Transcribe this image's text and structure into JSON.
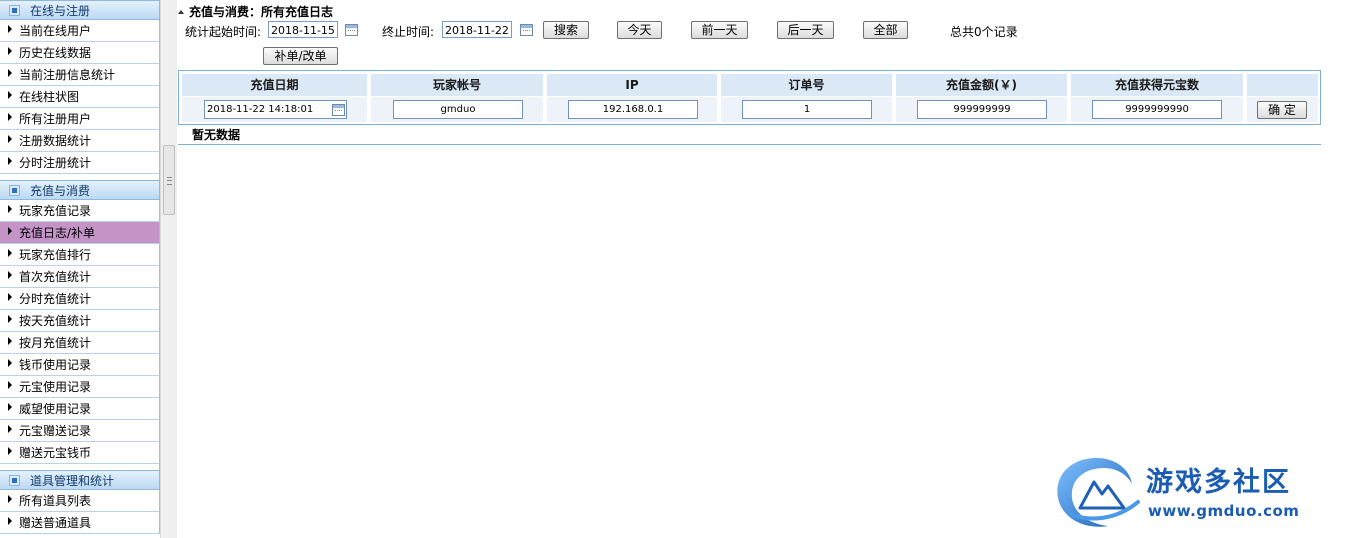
{
  "sidebar": {
    "groups": [
      {
        "title": "在线与注册",
        "items": [
          "当前在线用户",
          "历史在线数据",
          "当前注册信息统计",
          "在线柱状图",
          "所有注册用户",
          "注册数据统计",
          "分时注册统计"
        ]
      },
      {
        "title": "充值与消费",
        "items": [
          "玩家充值记录",
          "充值日志/补单",
          "玩家充值排行",
          "首次充值统计",
          "分时充值统计",
          "按天充值统计",
          "按月充值统计",
          "钱币使用记录",
          "元宝使用记录",
          "威望使用记录",
          "元宝赠送记录",
          "赠送元宝钱币"
        ]
      },
      {
        "title": "道具管理和统计",
        "items": [
          "所有道具列表",
          "赠送普通道具"
        ]
      }
    ],
    "active_item": "充值日志/补单"
  },
  "header": {
    "title": "充值与消费：所有充值日志"
  },
  "filter": {
    "start_label": "统计起始时间:",
    "start_value": "2018-11-15",
    "end_label": "终止时间:",
    "end_value": "2018-11-22",
    "search_label": "搜索",
    "today_label": "今天",
    "prev_day_label": "前一天",
    "next_day_label": "后一天",
    "all_label": "全部",
    "total_text": "总共0个记录",
    "supplement_label": "补单/改单"
  },
  "table": {
    "columns": [
      "充值日期",
      "玩家帐号",
      "IP",
      "订单号",
      "充值金额(￥)",
      "充值获得元宝数"
    ],
    "row": {
      "date": "2018-11-22 14:18:01",
      "account": "gmduo",
      "ip": "192.168.0.1",
      "order": "1",
      "amount": "999999999",
      "ingots": "9999999990"
    },
    "confirm_label": "确 定",
    "empty_text": "暂无数据"
  },
  "watermark": {
    "name": "游戏多社区",
    "url": "www.gmduo.com"
  },
  "colors": {
    "sidebar_header": "#c9e0f5",
    "active_item": "#c494c7",
    "table_header": "#dbe9f6",
    "border_blue": "#7fb0d9",
    "logo_blue": "#1a5db3"
  }
}
